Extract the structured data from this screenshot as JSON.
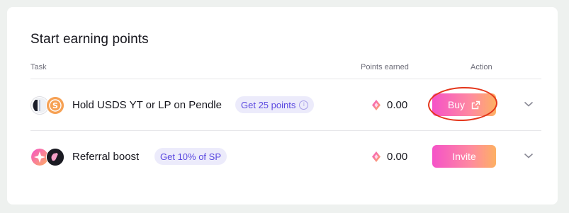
{
  "section": {
    "title": "Start earning points"
  },
  "table": {
    "headers": {
      "task": "Task",
      "points_earned": "Points earned",
      "action": "Action"
    },
    "rows": [
      {
        "task": "Hold USDS YT or LP on Pendle",
        "badge": "Get 25 points",
        "points": "0.00",
        "action": "Buy",
        "action_icon": "external-link-icon",
        "icons": [
          "pendle-icon",
          "usds-icon"
        ]
      },
      {
        "task": "Referral boost",
        "badge": "Get 10% of SP",
        "points": "0.00",
        "action": "Invite",
        "icons": [
          "star-icon",
          "waving-hand-icon"
        ]
      }
    ]
  },
  "colors": {
    "accent_gradient": [
      "#f552c8",
      "#fdb063"
    ],
    "badge_bg": "#ecebfb",
    "badge_text": "#5b49e0",
    "highlight": "#e4361b"
  }
}
